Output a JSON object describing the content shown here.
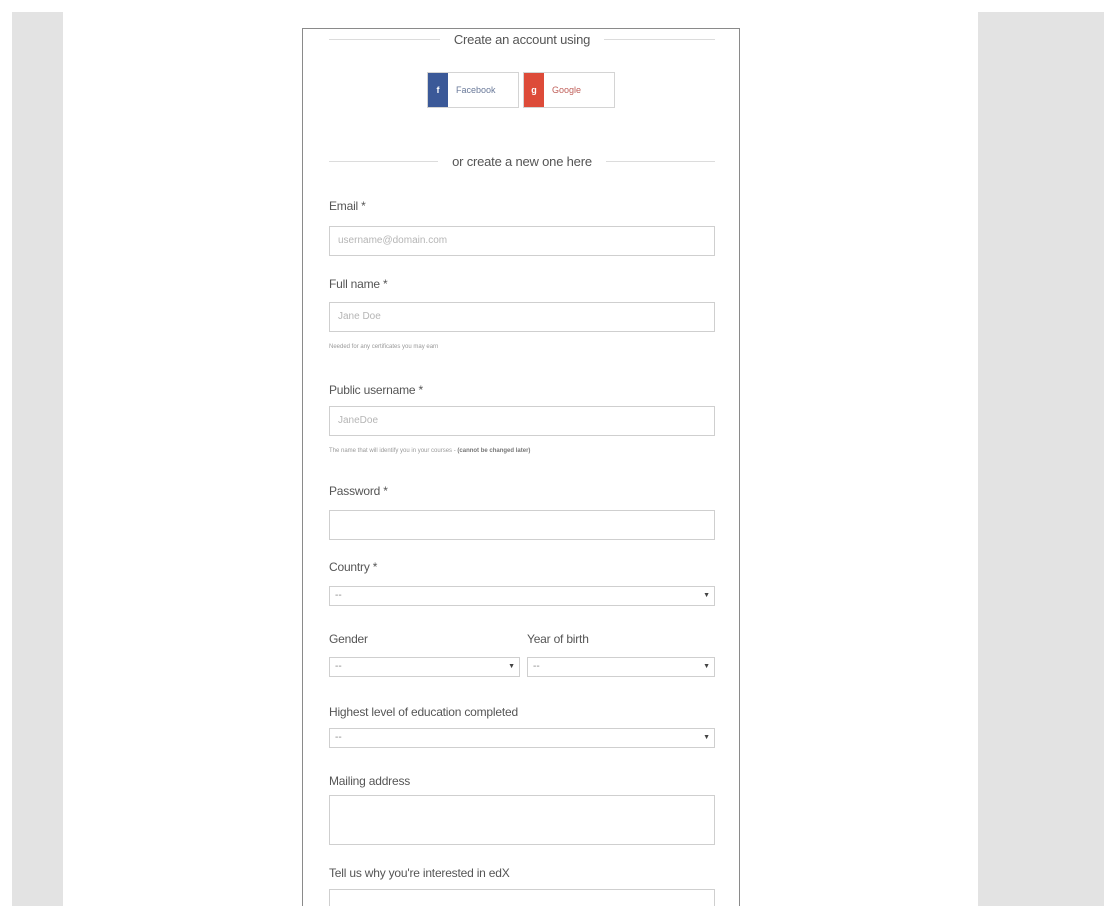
{
  "social": {
    "heading": "Create an account using",
    "facebook": {
      "icon": "f",
      "label": "Facebook",
      "color": "#3b5998"
    },
    "google": {
      "icon": "g",
      "label": "Google",
      "color": "#dd4b39"
    }
  },
  "divider": {
    "text": "or create a new one here"
  },
  "form": {
    "email": {
      "label": "Email *",
      "placeholder": "username@domain.com"
    },
    "full_name": {
      "label": "Full name *",
      "placeholder": "Jane Doe",
      "help": "Needed for any certificates you may earn"
    },
    "username": {
      "label": "Public username *",
      "placeholder": "JaneDoe",
      "help": "The name that will identify you in your courses - ",
      "help_emphasis": "(cannot be changed later)"
    },
    "password": {
      "label": "Password *",
      "value": ""
    },
    "country": {
      "label": "Country *",
      "selected": "--"
    },
    "gender": {
      "label": "Gender",
      "selected": "--"
    },
    "year_of_birth": {
      "label": "Year of birth",
      "selected": "--"
    },
    "education": {
      "label": "Highest level of education completed",
      "selected": "--"
    },
    "mailing_address": {
      "label": "Mailing address",
      "value": ""
    },
    "goals": {
      "label": "Tell us why you're interested in edX",
      "value": ""
    }
  }
}
